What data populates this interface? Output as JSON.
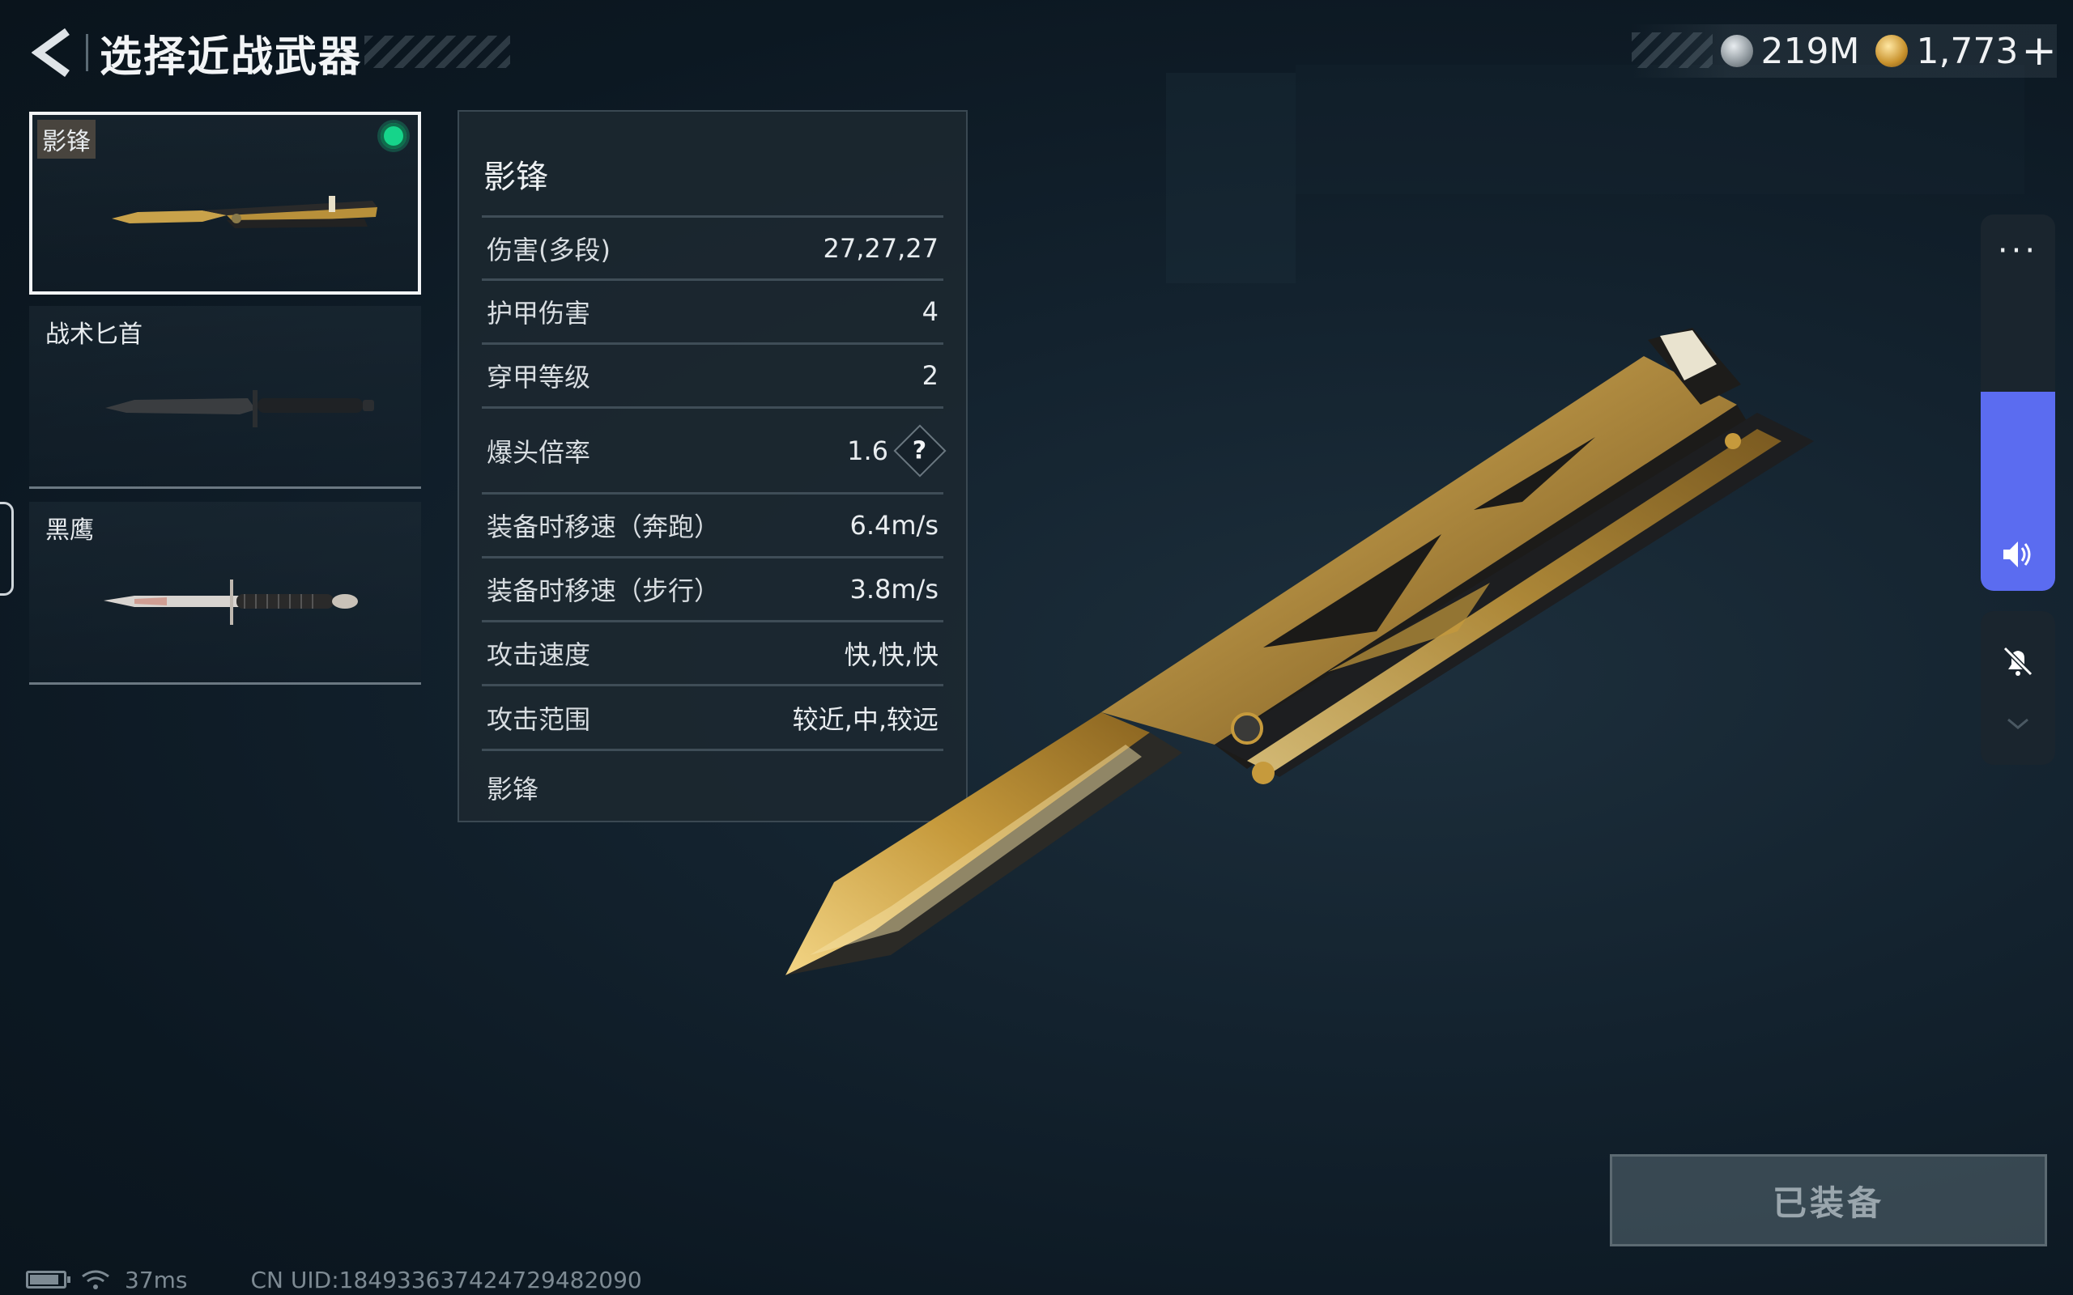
{
  "header": {
    "title": "选择近战武器"
  },
  "currency": {
    "silver": "219M",
    "gold": "1,773",
    "add_label": "+"
  },
  "weapons": [
    {
      "name": "影锋",
      "selected": true,
      "equipped": true
    },
    {
      "name": "战术匕首",
      "selected": false,
      "equipped": false
    },
    {
      "name": "黑鹰",
      "selected": false,
      "equipped": false
    }
  ],
  "stats": {
    "title": "影锋",
    "rows": [
      {
        "label": "伤害(多段)",
        "value": "27,27,27"
      },
      {
        "label": "护甲伤害",
        "value": "4"
      },
      {
        "label": "穿甲等级",
        "value": "2"
      },
      {
        "label": "爆头倍率",
        "value": "1.6",
        "help": "?"
      },
      {
        "label": "装备时移速（奔跑）",
        "value": "6.4m/s"
      },
      {
        "label": "装备时移速（步行）",
        "value": "3.8m/s"
      },
      {
        "label": "攻击速度",
        "value": "快,快,快"
      },
      {
        "label": "攻击范围",
        "value": "较近,中,较远"
      }
    ],
    "footer": "影锋"
  },
  "equip_button": {
    "label": "已装备"
  },
  "status_bar": {
    "ping": "37ms",
    "uid": "CN UID:184933637424729482090"
  },
  "controls": {
    "more_label": "···",
    "volume_level": 0.53
  },
  "colors": {
    "accent_equipped": "#16d48a",
    "volume_blue": "#5b6cf0"
  }
}
